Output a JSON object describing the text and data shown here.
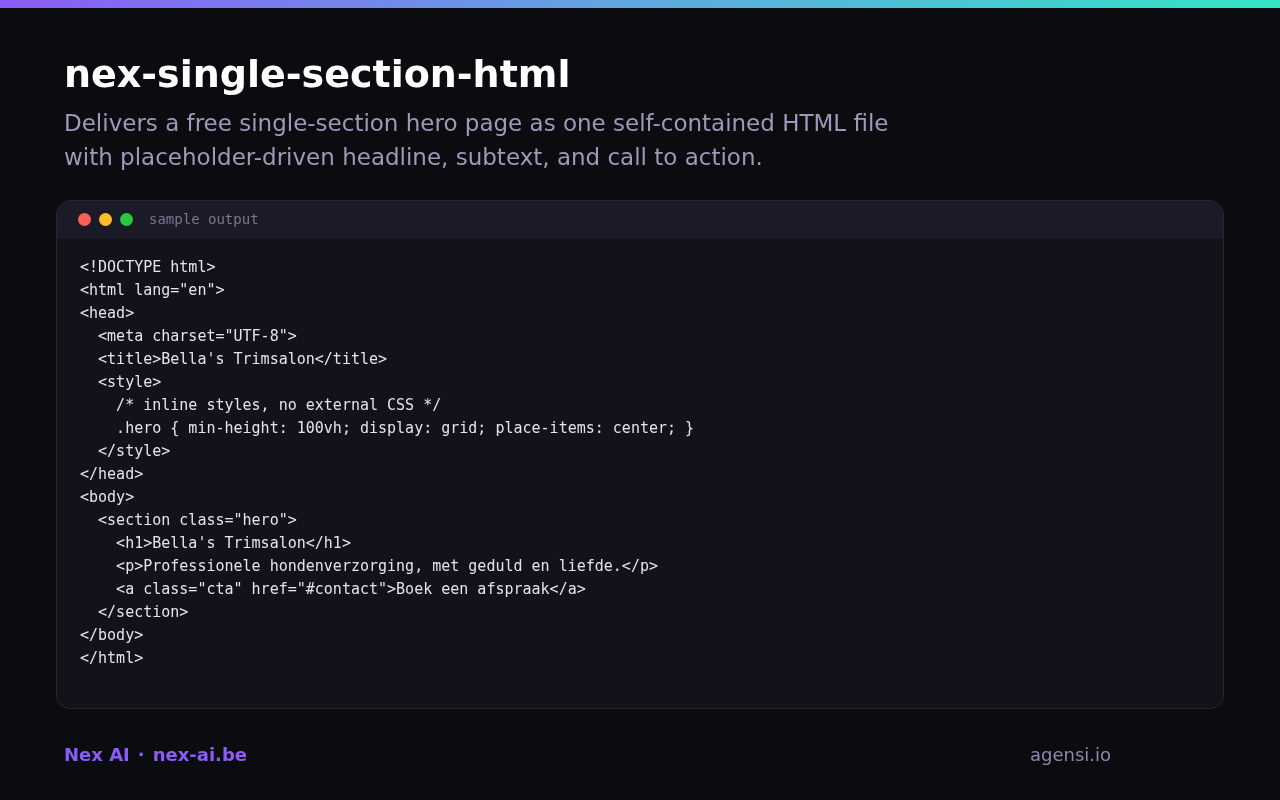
{
  "title": "nex-single-section-html",
  "subtitle": "Delivers a free single-section hero page as one self-contained HTML file with placeholder-driven headline, subtext, and call to action.",
  "window": {
    "dots": [
      {
        "color": "#ff5f57"
      },
      {
        "color": "#febc2e"
      },
      {
        "color": "#28c840"
      }
    ],
    "label": "sample output"
  },
  "code_lines": [
    "<!DOCTYPE html>",
    "<html lang=\"en\">",
    "<head>",
    "  <meta charset=\"UTF-8\">",
    "  <title>Bella's Trimsalon</title>",
    "  <style>",
    "    /* inline styles, no external CSS */",
    "    .hero { min-height: 100vh; display: grid; place-items: center; }",
    "  </style>",
    "</head>",
    "<body>",
    "  <section class=\"hero\">",
    "    <h1>Bella's Trimsalon</h1>",
    "    <p>Professionele hondenverzorging, met geduld en liefde.</p>",
    "    <a class=\"cta\" href=\"#contact\">Boek een afspraak</a>",
    "  </section>",
    "</body>",
    "</html>"
  ],
  "footer": {
    "brand": "Nex AI",
    "separator": "·",
    "site": "nex-ai.be",
    "credit": "agensi.io"
  }
}
